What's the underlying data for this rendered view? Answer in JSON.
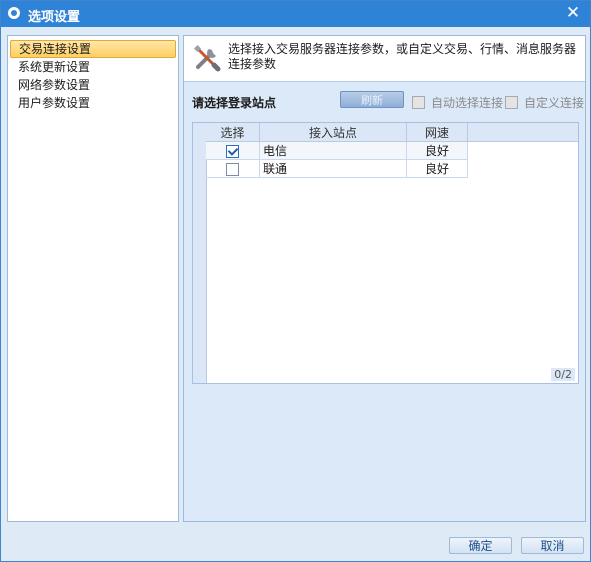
{
  "window": {
    "title": "选项设置",
    "close_glyph": "✕"
  },
  "sidebar": {
    "items": [
      {
        "label": "交易连接设置",
        "active": true
      },
      {
        "label": "系统更新设置",
        "active": false
      },
      {
        "label": "网络参数设置",
        "active": false
      },
      {
        "label": "用户参数设置",
        "active": false
      }
    ]
  },
  "main": {
    "header_icon": "tools-icon",
    "header_text": "选择接入交易服务器连接参数，或自定义交易、行情、消息服务器连接参数",
    "site_label": "请选择登录站点",
    "refresh_label": "刷新",
    "auto_connect_label": "自动选择连接",
    "custom_connect_label": "自定义连接",
    "table": {
      "headers": [
        "选择",
        "接入站点",
        "网速"
      ],
      "rows": [
        {
          "checked": true,
          "site": "电信",
          "speed": "良好"
        },
        {
          "checked": false,
          "site": "联通",
          "speed": "良好"
        }
      ],
      "counter": "0/2"
    }
  },
  "footer": {
    "ok_label": "确定",
    "cancel_label": "取消"
  },
  "colors": {
    "titlebar": "#2f83d6",
    "accent_selected": "#ffcf63",
    "panel_bg": "#dce9f8"
  }
}
